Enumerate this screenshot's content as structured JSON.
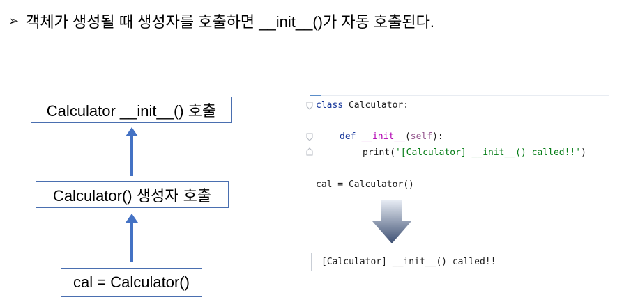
{
  "heading": {
    "bullet": "➢",
    "text": "객체가 생성될 때 생성자를 호출하면 __init__()가 자동 호출된다."
  },
  "flow": {
    "box_top": "Calculator __init__() 호출",
    "box_middle": "Calculator() 생성자 호출",
    "box_bottom": "cal = Calculator()"
  },
  "code": {
    "line1_kw": "class",
    "line1_rest": " Calculator:",
    "line2_kw": "def",
    "line2_name": "__init__",
    "line2_paren_open": "(",
    "line2_self": "self",
    "line2_paren_close": "):",
    "line3_fn": "print(",
    "line3_str": "'[Calculator] __init__() called!!'",
    "line3_end": ")",
    "line4": "cal = Calculator()"
  },
  "output": {
    "text": "[Calculator] __init__() called!!"
  },
  "colors": {
    "arrow": "#4472c4",
    "box_border": "#4a6fb0"
  }
}
